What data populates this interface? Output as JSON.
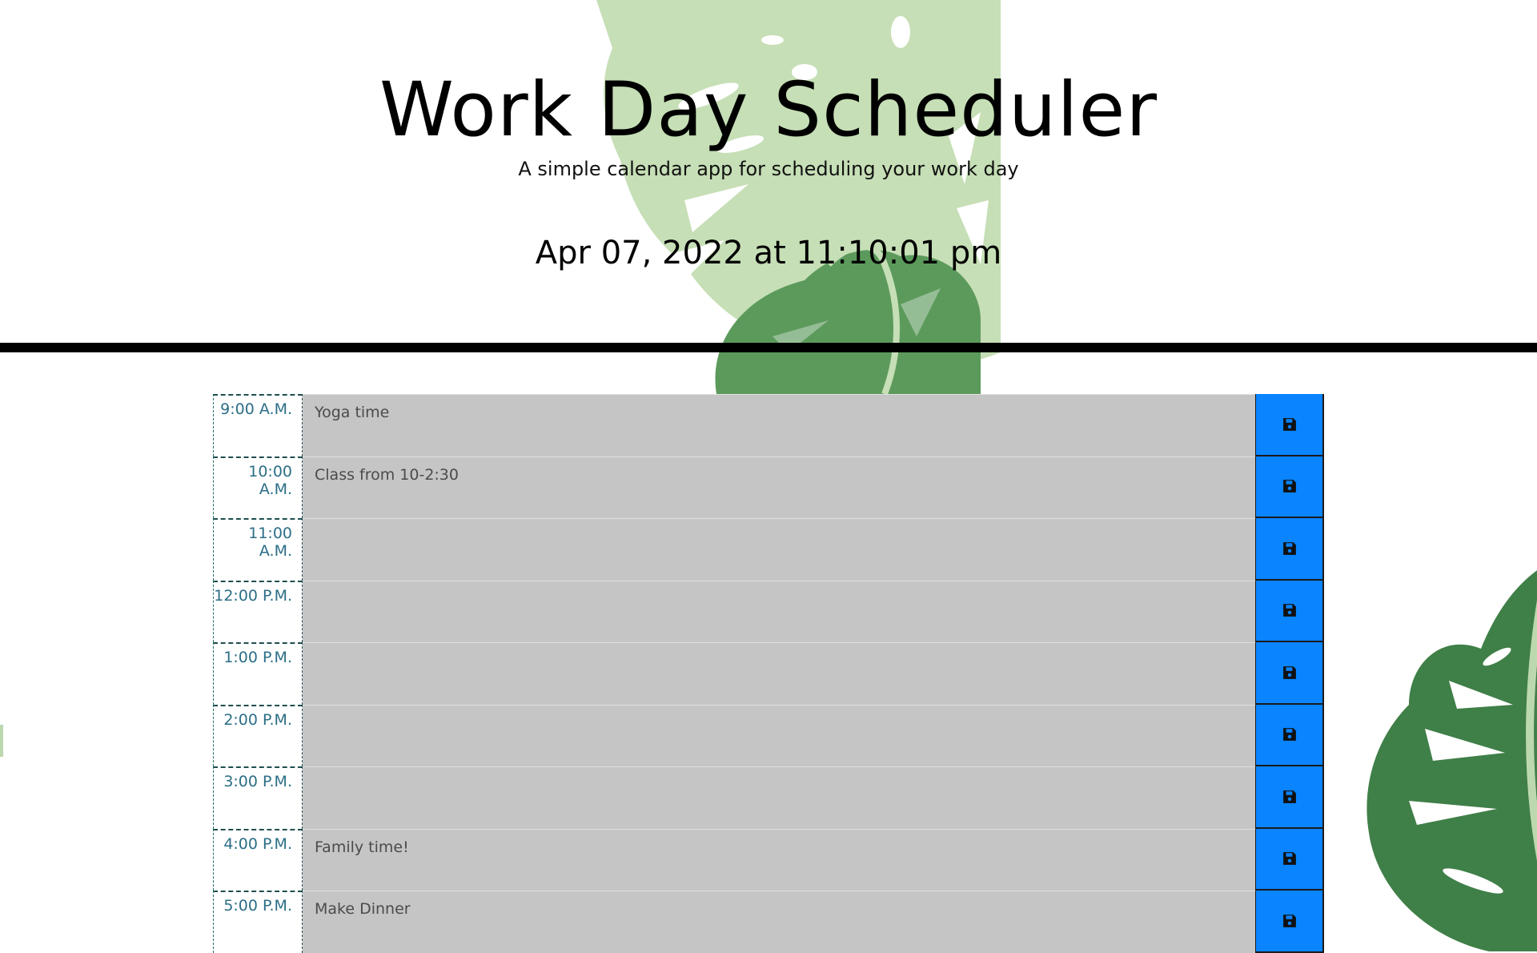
{
  "header": {
    "title": "Work Day Scheduler",
    "lead": "A simple calendar app for scheduling your work day",
    "current_day": "Apr 07, 2022 at 11:10:01 pm"
  },
  "schedule": [
    {
      "hour": "9:00 A.M.",
      "text": "Yoga time",
      "status": "past"
    },
    {
      "hour": "10:00 A.M.",
      "text": "Class from 10-2:30",
      "status": "past"
    },
    {
      "hour": "11:00 A.M.",
      "text": "",
      "status": "past"
    },
    {
      "hour": "12:00 P.M.",
      "text": "",
      "status": "past"
    },
    {
      "hour": "1:00 P.M.",
      "text": "",
      "status": "past"
    },
    {
      "hour": "2:00 P.M.",
      "text": "",
      "status": "past"
    },
    {
      "hour": "3:00 P.M.",
      "text": "",
      "status": "past"
    },
    {
      "hour": "4:00 P.M.",
      "text": "Family time!",
      "status": "past"
    },
    {
      "hour": "5:00 P.M.",
      "text": "Make Dinner",
      "status": "past"
    }
  ],
  "save_icon": "floppy-disk-icon",
  "colors": {
    "past": "#c5c5c5",
    "save_button": "#0a84ff",
    "hour_text": "#2b6e86",
    "divider": "#000000"
  }
}
